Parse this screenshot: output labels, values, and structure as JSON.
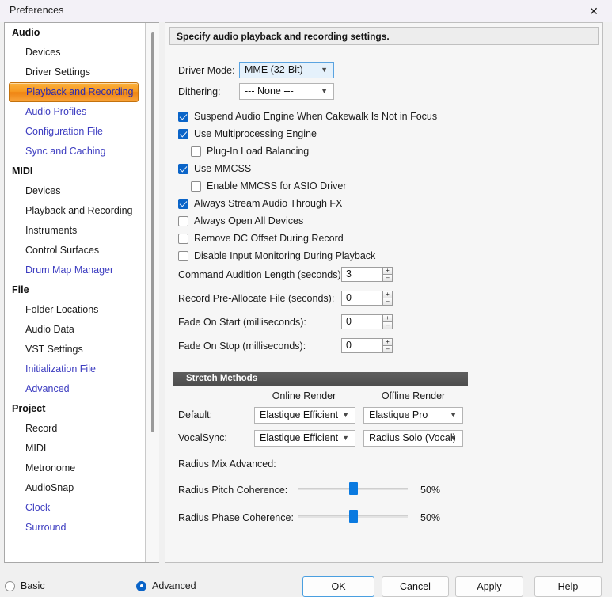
{
  "window": {
    "title": "Preferences",
    "close_icon": "close-icon"
  },
  "sidebar": {
    "items": [
      {
        "label": "Audio",
        "type": "group"
      },
      {
        "label": "Devices",
        "type": "leaf"
      },
      {
        "label": "Driver Settings",
        "type": "leaf"
      },
      {
        "label": "Playback and Recording",
        "type": "selected"
      },
      {
        "label": "Audio Profiles",
        "type": "link"
      },
      {
        "label": "Configuration File",
        "type": "link"
      },
      {
        "label": "Sync and Caching",
        "type": "link"
      },
      {
        "label": "MIDI",
        "type": "group"
      },
      {
        "label": "Devices",
        "type": "leaf"
      },
      {
        "label": "Playback and Recording",
        "type": "leaf"
      },
      {
        "label": "Instruments",
        "type": "leaf"
      },
      {
        "label": "Control Surfaces",
        "type": "leaf"
      },
      {
        "label": "Drum Map Manager",
        "type": "link"
      },
      {
        "label": "File",
        "type": "group"
      },
      {
        "label": "Folder Locations",
        "type": "leaf"
      },
      {
        "label": "Audio Data",
        "type": "leaf"
      },
      {
        "label": "VST Settings",
        "type": "leaf"
      },
      {
        "label": "Initialization File",
        "type": "link"
      },
      {
        "label": "Advanced",
        "type": "link"
      },
      {
        "label": "Project",
        "type": "group"
      },
      {
        "label": "Record",
        "type": "leaf"
      },
      {
        "label": "MIDI",
        "type": "leaf"
      },
      {
        "label": "Metronome",
        "type": "leaf"
      },
      {
        "label": "AudioSnap",
        "type": "leaf"
      },
      {
        "label": "Clock",
        "type": "link"
      },
      {
        "label": "Surround",
        "type": "link"
      }
    ]
  },
  "content": {
    "banner": "Specify audio playback and recording settings.",
    "driver_mode": {
      "label": "Driver Mode:",
      "value": "MME (32-Bit)"
    },
    "dithering": {
      "label": "Dithering:",
      "value": "--- None ---"
    },
    "checkboxes": [
      {
        "label": "Suspend Audio Engine When Cakewalk Is Not in Focus",
        "checked": true,
        "indent": 0
      },
      {
        "label": "Use Multiprocessing Engine",
        "checked": true,
        "indent": 0
      },
      {
        "label": "Plug-In Load Balancing",
        "checked": false,
        "indent": 1
      },
      {
        "label": "Use MMCSS",
        "checked": true,
        "indent": 0
      },
      {
        "label": "Enable MMCSS for ASIO Driver",
        "checked": false,
        "indent": 1
      },
      {
        "label": "Always Stream Audio Through FX",
        "checked": true,
        "indent": 0
      },
      {
        "label": "Always Open All Devices",
        "checked": false,
        "indent": 0
      },
      {
        "label": "Remove DC Offset During Record",
        "checked": false,
        "indent": 0
      },
      {
        "label": "Disable Input Monitoring During Playback",
        "checked": false,
        "indent": 0
      }
    ],
    "spinners": [
      {
        "label": "Command Audition Length (seconds):",
        "value": "3"
      },
      {
        "label": "Record Pre-Allocate File (seconds):",
        "value": "0"
      },
      {
        "label": "Fade On Start  (milliseconds):",
        "value": "0"
      },
      {
        "label": "Fade On Stop  (milliseconds):",
        "value": "0"
      }
    ],
    "stretch": {
      "section_title": "Stretch Methods",
      "col_online": "Online Render",
      "col_offline": "Offline Render",
      "rows": [
        {
          "label": "Default:",
          "online": "Elastique Efficient",
          "offline": "Elastique Pro"
        },
        {
          "label": "VocalSync:",
          "online": "Elastique Efficient",
          "offline": "Radius Solo (Vocal)"
        }
      ]
    },
    "radius": {
      "group_label": "Radius Mix Advanced:",
      "sliders": [
        {
          "label": "Radius Pitch Coherence:",
          "value": "50%",
          "percent": 50
        },
        {
          "label": "Radius Phase Coherence:",
          "value": "50%",
          "percent": 50
        }
      ]
    },
    "spin_up_icon": "plus-icon",
    "spin_down_icon": "minus-icon",
    "combo_arrow_icon": "chevron-down-icon"
  },
  "footer": {
    "modes": [
      {
        "label": "Basic",
        "selected": false
      },
      {
        "label": "Advanced",
        "selected": true
      }
    ],
    "buttons": [
      {
        "label": "OK",
        "primary": true
      },
      {
        "label": "Cancel",
        "primary": false
      },
      {
        "label": "Apply",
        "primary": false
      },
      {
        "label": "Help",
        "primary": false
      }
    ]
  },
  "colors": {
    "accent_blue": "#0a64c8",
    "selected_orange": "#f79a22",
    "link_blue": "#3c3cc0",
    "focus_border": "#4a9fe0"
  }
}
